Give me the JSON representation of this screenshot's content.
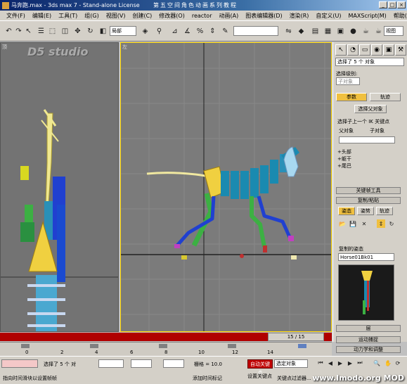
{
  "window": {
    "title": "马奔跑.max - 3ds max 7 - Stand-alone License",
    "course_title": "第五空间角色动画系列教程"
  },
  "menu": [
    "文件(F)",
    "编辑(E)",
    "工具(T)",
    "组(G)",
    "视图(V)",
    "创建(C)",
    "修改器(O)",
    "reactor",
    "动画(A)",
    "图表编辑器(D)",
    "渲染(R)",
    "自定义(U)",
    "MAXScript(M)",
    "帮助(H)"
  ],
  "toolbar": {
    "ref_coord": "局部",
    "selection_set": ""
  },
  "viewports": {
    "left_label": "顶",
    "persp_label": "左",
    "watermark": "D5 studio"
  },
  "command_panel": {
    "selection_field": "选择了 5 个 对象",
    "selection_level_label": "选择级别:",
    "sub_object": "子对象",
    "tab_params": "参数",
    "tab_track": "轨迹",
    "select_parent_btn": "选择父对象",
    "checkbox_label": "选择子上一个 IK 关键点",
    "radio_parent": "父对象",
    "radio_child": "子对象",
    "items": [
      "+头部",
      "+躯干",
      "+尾巴"
    ],
    "keyframe_tools": "关键帧工具",
    "copy_paste": "复制/粘贴",
    "btn_posture": "姿态",
    "btn_pose": "姿势",
    "btn_track": "轨迹",
    "copied_posture_label": "复制的姿态",
    "posture_name": "Horse01Bk01",
    "layer_rollout": "层",
    "motion_rollout": "运动捕捉",
    "physics_rollout": "动力学和调整"
  },
  "time": {
    "frame": "15 / 15",
    "ticks": [
      "0",
      "2",
      "4",
      "6",
      "8",
      "10",
      "12",
      "14"
    ]
  },
  "status": {
    "selected": "选择了 5 个 对",
    "grid": "栅格 = 10.0",
    "auto_key": "自动关键点",
    "set_key": "设置关键点",
    "selected_objects": "选定对象",
    "key_filters": "关键点过滤器...",
    "prompt": "指向时间滑块以设置帧帧",
    "add_time_tag": "添加时间标记",
    "site_watermark": "www.Imodo.org  MOD"
  },
  "colors": {
    "title_blue": "#0a246a",
    "timeline_red": "#b00000",
    "spine_blue": "#1a8ab0",
    "leg_green": "#3cb043",
    "leg_blue": "#2040d0",
    "pelvis_yellow": "#f0d040",
    "head_lightblue": "#a8d8f0"
  }
}
